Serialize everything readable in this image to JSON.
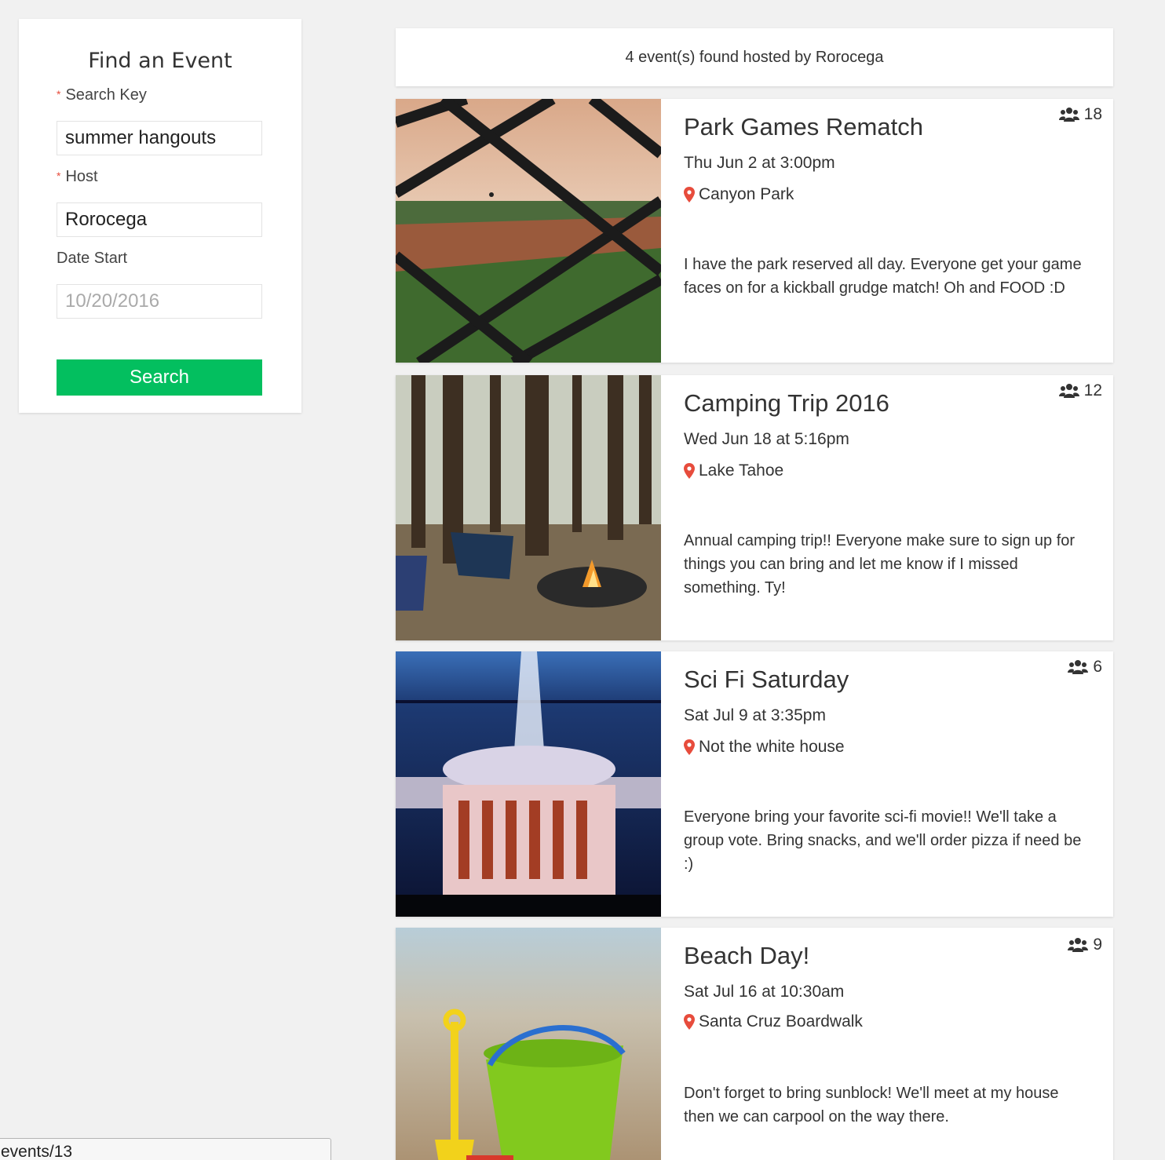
{
  "search": {
    "title": "Find an Event",
    "search_key_label": "Search Key",
    "search_key_value": "summer hangouts",
    "host_label": "Host",
    "host_value": "Rorocega",
    "date_start_label": "Date Start",
    "date_start_placeholder": "10/20/2016",
    "button_label": "Search",
    "required_marker": "*"
  },
  "results": {
    "summary": "4 event(s) found hosted by Rorocega"
  },
  "events": [
    {
      "title": "Park Games Rematch",
      "date": "Thu Jun 2 at 3:00pm",
      "location": "Canyon Park",
      "description": "I have the park reserved all day. Everyone get your game faces on for a kickball grudge match! Oh and FOOD :D",
      "attendees": "18",
      "image": "park-fence-photo"
    },
    {
      "title": "Camping Trip 2016",
      "date": "Wed Jun 18 at 5:16pm",
      "location": "Lake Tahoe",
      "description": "Annual camping trip!! Everyone make sure to sign up for things you can bring and let me know if I missed something. Ty!",
      "attendees": "12",
      "image": "campfire-forest-photo"
    },
    {
      "title": "Sci Fi Saturday",
      "date": "Sat Jul 9 at 3:35pm",
      "location": "Not the white house",
      "description": "Everyone bring your favorite sci-fi movie!! We'll take a group vote. Bring snacks, and we'll order pizza if need be :)",
      "attendees": "6",
      "image": "white-house-beam-photo"
    },
    {
      "title": "Beach Day!",
      "date": "Sat Jul 16 at 10:30am",
      "location": "Santa Cruz Boardwalk",
      "description": "Don't forget to bring sunblock! We'll meet at my house then we can carpool on the way there.",
      "attendees": "9",
      "image": "beach-bucket-photo"
    }
  ],
  "colors": {
    "accent_green": "#03bf5f",
    "pin_red": "#e74c3c",
    "background": "#f1f1f1"
  },
  "status_bar": {
    "url_fragment": "events/13"
  }
}
